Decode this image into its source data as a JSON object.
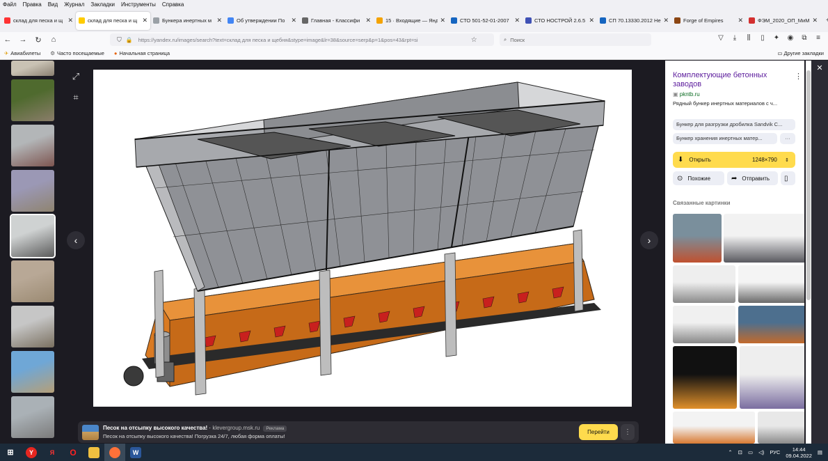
{
  "menu": [
    "Файл",
    "Правка",
    "Вид",
    "Журнал",
    "Закладки",
    "Инструменты",
    "Справка"
  ],
  "tabs": [
    {
      "title": "склад для песка и щ",
      "color": "#ff3333",
      "active": false
    },
    {
      "title": "склад для песка и щ",
      "color": "#ffcc00",
      "active": true
    },
    {
      "title": "Бункера инертных м",
      "color": "#9aa0a6",
      "active": false
    },
    {
      "title": "Об утверждении По",
      "color": "#4285f4",
      "active": false
    },
    {
      "title": "Главная - Классифи",
      "color": "#666666",
      "active": false
    },
    {
      "title": "15 · Входящие — Янд",
      "color": "#f4a300",
      "active": false
    },
    {
      "title": "СТО 501-52-01-2007",
      "color": "#1565c0",
      "active": false
    },
    {
      "title": "СТО НОСТРОЙ 2.6.5",
      "color": "#3f51b5",
      "active": false
    },
    {
      "title": "СП 70.13330.2012 Не",
      "color": "#1565c0",
      "active": false
    },
    {
      "title": "Forge of Empires",
      "color": "#8b4513",
      "active": false
    },
    {
      "title": "ФЭМ_2020_ОП_МиМ.p",
      "color": "#d32f2f",
      "active": false
    }
  ],
  "address": {
    "url": "https://yandex.ru/images/search?text=склад для песка и щебня&stype=image&lr=38&source=serp&p=1&pos=43&rpt=si",
    "search_placeholder": "Поиск"
  },
  "bookmarks": [
    "Авиабилеты",
    "Часто посещаемые",
    "Начальная страница"
  ],
  "bookmarks_other": "Другие закладки",
  "thumbs": [
    {
      "colors": [
        "#c9c2b4",
        "#8a8071"
      ]
    },
    {
      "colors": [
        "#4f6a2e",
        "#8a7d6a"
      ]
    },
    {
      "colors": [
        "#b3b6b8",
        "#7d5550"
      ]
    },
    {
      "colors": [
        "#9b98b5",
        "#8f8470"
      ]
    },
    {
      "colors": [
        "#cfd2d2",
        "#5b5b5b"
      ]
    },
    {
      "colors": [
        "#b8a896",
        "#9b8a72"
      ]
    },
    {
      "colors": [
        "#c6c6c6",
        "#7a7060"
      ]
    },
    {
      "colors": [
        "#6fa7d6",
        "#b59f78"
      ]
    },
    {
      "colors": [
        "#aab1b6",
        "#7b7b7b"
      ]
    }
  ],
  "ad": {
    "title": "Песок на отсыпку высокого качества!",
    "site": "klevergroup.msk.ru",
    "tag": "Реклама",
    "description": "Песок на отсыпку высокого качества! Погрузка 24/7, любая форма оплаты!",
    "button": "Перейти"
  },
  "panel": {
    "title": "Комплектующие бетонных заводов",
    "domain": "pkntb.ru",
    "description": "Рядный бункер инертных материалов с ч...",
    "chips": [
      "Бункер для разгрузки дробилка Sandvik C...",
      "Бункер хранения инертных матер..."
    ],
    "chip_more": "···",
    "open_label": "Открыть",
    "size": "1248×790",
    "similar_label": "Похожие",
    "share_label": "Отправить",
    "related_heading": "Связанные картинки",
    "related": [
      {
        "colors": [
          "#7a8f9c",
          "#c0512f"
        ]
      },
      {
        "colors": [
          "#f2f2f2",
          "#59595f"
        ]
      },
      {
        "colors": [
          "#eeeeee",
          "#8a8a8a"
        ]
      },
      {
        "colors": [
          "#f4f4f4",
          "#6a6a6a"
        ]
      },
      {
        "colors": [
          "#f0f0f0",
          "#888888"
        ]
      },
      {
        "colors": [
          "#4d6f8e",
          "#c26a2c"
        ]
      },
      {
        "colors": [
          "#111111",
          "#e0902a"
        ]
      },
      {
        "colors": [
          "#eeeeee",
          "#7a6da0"
        ]
      },
      {
        "colors": [
          "#f3f3f3",
          "#d87a32"
        ]
      },
      {
        "colors": [
          "#e8e8e8",
          "#8a8a8a"
        ]
      }
    ]
  },
  "taskbar": {
    "lang": "РУС",
    "time": "14:44",
    "date": "09.04.2022"
  }
}
